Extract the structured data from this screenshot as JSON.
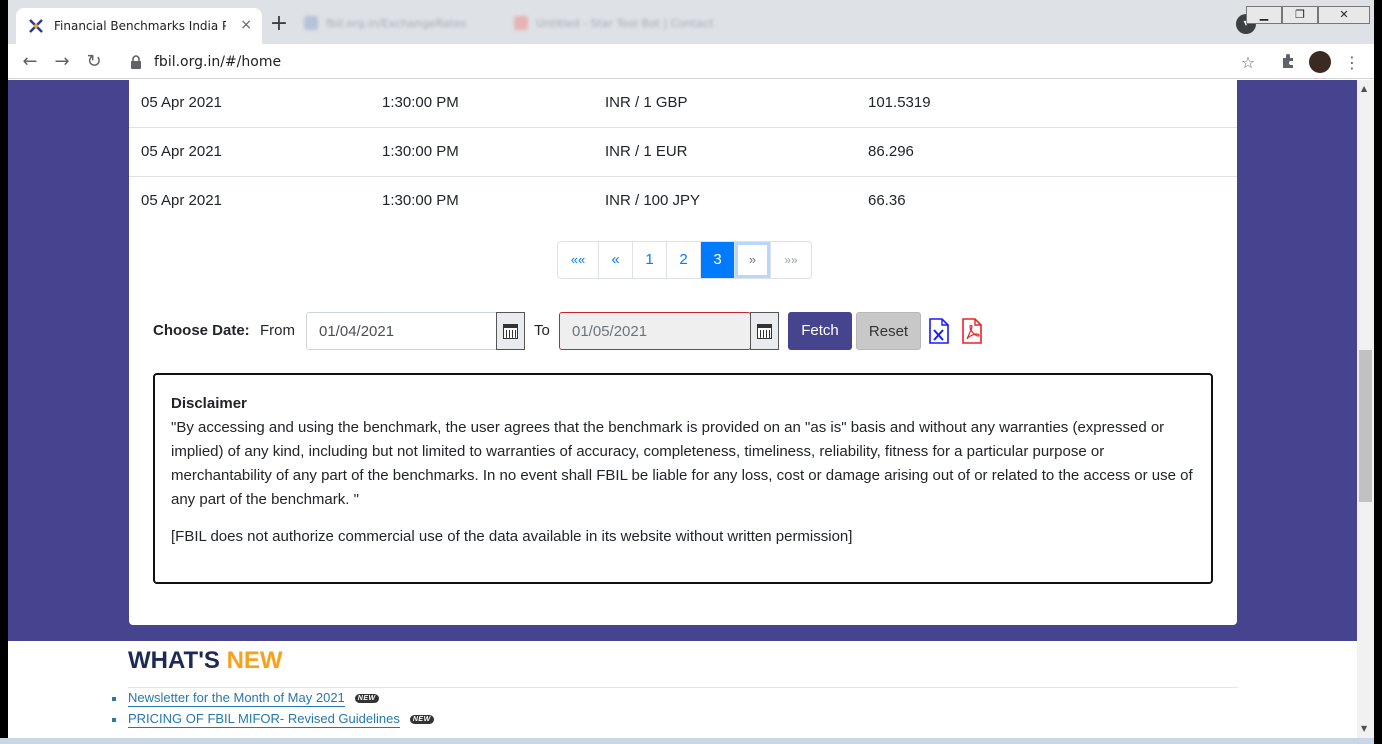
{
  "browser": {
    "tab_title": "Financial Benchmarks India Pvt Lt",
    "tab_close": "×",
    "new_tab": "+",
    "ghost_tab_1": "fbil.org.in/ExchangeRates",
    "ghost_tab_2": "Untitled - Star Tool Bot | Contact",
    "url": "fbil.org.in/#/home",
    "back": "←",
    "forward": "→",
    "reload": "↻",
    "lock": "🔒",
    "star": "☆",
    "extensions": "✦",
    "menu": "⋮",
    "win_min": "▁",
    "win_max": "❐",
    "win_close": "✕"
  },
  "table": {
    "rows": [
      {
        "date": "05 Apr 2021",
        "time": "1:30:00 PM",
        "currency": "INR / 1 GBP",
        "rate": "101.5319"
      },
      {
        "date": "05 Apr 2021",
        "time": "1:30:00 PM",
        "currency": "INR / 1 EUR",
        "rate": "86.296"
      },
      {
        "date": "05 Apr 2021",
        "time": "1:30:00 PM",
        "currency": "INR / 100 JPY",
        "rate": "66.36"
      }
    ]
  },
  "pagination": {
    "first": "««",
    "prev": "«",
    "pages": [
      "1",
      "2",
      "3"
    ],
    "current": "3",
    "next": "»",
    "last": "»»"
  },
  "date_filter": {
    "label": "Choose Date:",
    "from_label": "From",
    "from_value": "01/04/2021",
    "to_label": "To",
    "to_value": "01/05/2021",
    "fetch": "Fetch",
    "reset": "Reset"
  },
  "disclaimer": {
    "title": "Disclaimer",
    "body": "\"By accessing and using the benchmark, the user agrees that the benchmark is provided on an \"as is\" basis and without any warranties (expressed or implied) of any kind, including but not limited to warranties of accuracy, completeness, timeliness, reliability, fitness for a particular purpose or merchantability of any part of the benchmarks. In no event shall FBIL be liable for any loss, cost or damage arising out of or related to the access or use of any part of the benchmark. \"",
    "note": "[FBIL does not authorize commercial use of the data available in its website without written permission]"
  },
  "whats_new": {
    "title_a": "WHAT'S ",
    "title_b": "NEW",
    "items": [
      {
        "text": "Newsletter for the Month of May 2021",
        "badge": "NEW"
      },
      {
        "text": "PRICING OF FBIL MIFOR- Revised Guidelines",
        "badge": "NEW"
      }
    ]
  },
  "colors": {
    "brand_purple": "#46448f",
    "link_blue": "#007bff",
    "accent_orange": "#f7a21a",
    "navy": "#1c2a57"
  }
}
